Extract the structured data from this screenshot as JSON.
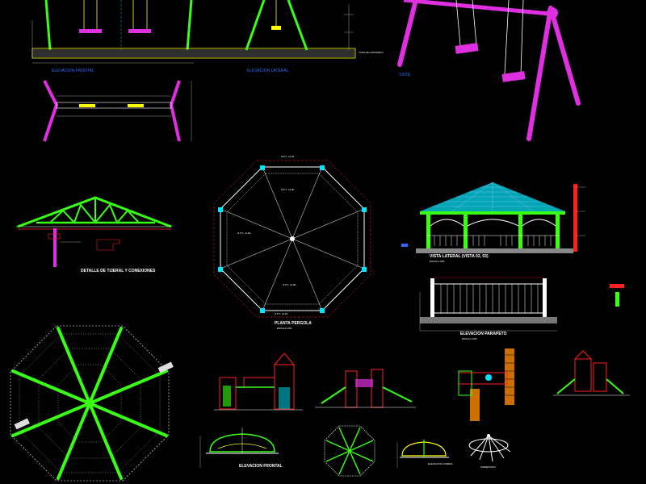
{
  "colors": {
    "background": "#000000",
    "green": "#39ff14",
    "magenta": "#e02fe0",
    "white": "#ffffff",
    "red": "#ff2020",
    "cyan": "#00e5ff",
    "yellow": "#ffff00",
    "blue": "#2a6bff",
    "grey": "#9a9a9a"
  },
  "labels": {
    "elev_frontal_swing": "ELEVACION FRONTAL",
    "elev_lateral_swing": "ELEVACION LATERAL",
    "vista": "VISTA",
    "concrete_note": "LOSA DE CONCRETO",
    "truss_title": "DETALLE DE TIJERAL Y CONEXIONES",
    "pergola_plan_title": "PLANTA PERGOLA",
    "pergola_plan_scale": "ESCALA 1/50",
    "lateral_view_title": "VISTA LATERAL (VISTA 02, 03)",
    "lateral_view_scale": "ESCALA 1/50",
    "parapet_title": "ELEVACION PARAPETO",
    "parapet_scale": "ESCALA 1/25",
    "carousel_front_title": "ELEVACION FRONTAL",
    "carousel_side_title": "ELEVACION LATERAL",
    "carousel_iso_title": "ISOMETRICO",
    "npt_top": "N.P.T. +0.15",
    "npt_center": "N.P.T. +0.00",
    "npt_bottom": "N.P.T. +0.15",
    "npt_left": "N.P.T. +0.00",
    "npt_lower": "N.P.T. +0.00"
  }
}
